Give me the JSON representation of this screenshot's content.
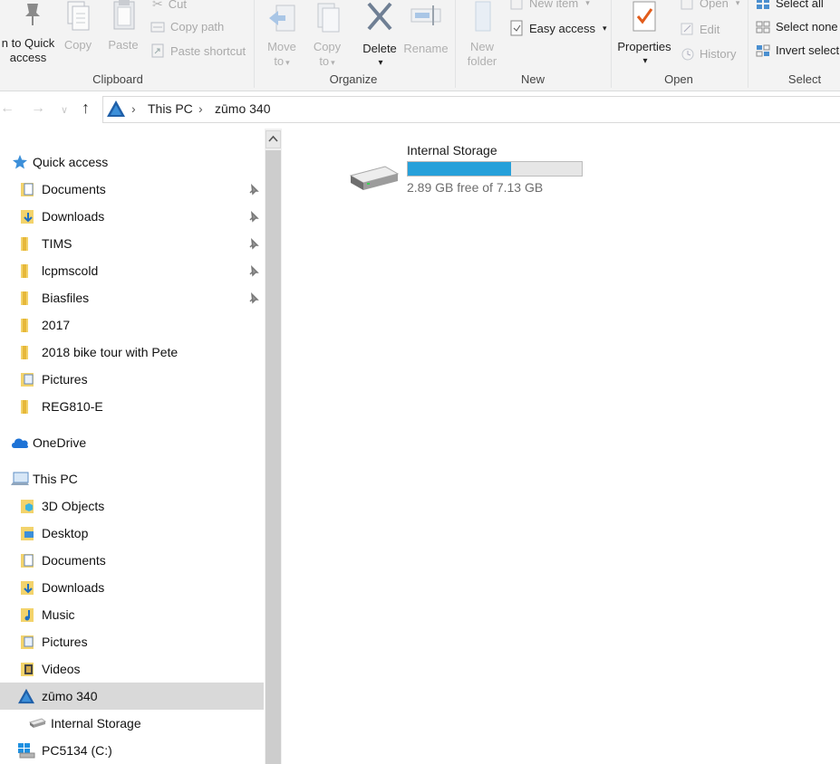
{
  "ribbon": {
    "clipboard": {
      "label": "Clipboard",
      "pin_line1": "n to Quick",
      "pin_line2": "access",
      "copy": "Copy",
      "paste": "Paste",
      "cut": "Cut",
      "copy_path": "Copy path",
      "paste_shortcut": "Paste shortcut"
    },
    "organize": {
      "label": "Organize",
      "move_to_1": "Move",
      "move_to_2": "to",
      "copy_to_1": "Copy",
      "copy_to_2": "to",
      "delete": "Delete",
      "rename": "Rename"
    },
    "new": {
      "label": "New",
      "new_folder_1": "New",
      "new_folder_2": "folder",
      "new_item": "New item",
      "easy_access": "Easy access"
    },
    "open": {
      "label": "Open",
      "properties": "Properties",
      "open": "Open",
      "edit": "Edit",
      "history": "History"
    },
    "select": {
      "label": "Select",
      "select_all": "Select all",
      "select_none": "Select none",
      "invert_selection": "Invert selecti"
    }
  },
  "address": {
    "crumbs": [
      "This PC",
      "zūmo 340"
    ]
  },
  "nav": {
    "quick_access": "Quick access",
    "quick_items": [
      "Documents",
      "Downloads",
      "TIMS",
      "lcpmscold",
      "Biasfiles",
      "2017",
      "2018 bike tour with Pete",
      "Pictures",
      "REG810-E"
    ],
    "onedrive": "OneDrive",
    "this_pc": "This PC",
    "pc_items": [
      "3D Objects",
      "Desktop",
      "Documents",
      "Downloads",
      "Music",
      "Pictures",
      "Videos"
    ],
    "device": "zūmo 340",
    "device_child": "Internal Storage",
    "c_drive": "PC5134 (C:)"
  },
  "content": {
    "drive_name": "Internal Storage",
    "free_text": "2.89 GB free of 7.13 GB",
    "used_fraction": 0.595
  },
  "colors": {
    "accent": "#26a0da",
    "selected_bg": "#d9d9d9",
    "ribbon_bg": "#f3f3f3"
  }
}
